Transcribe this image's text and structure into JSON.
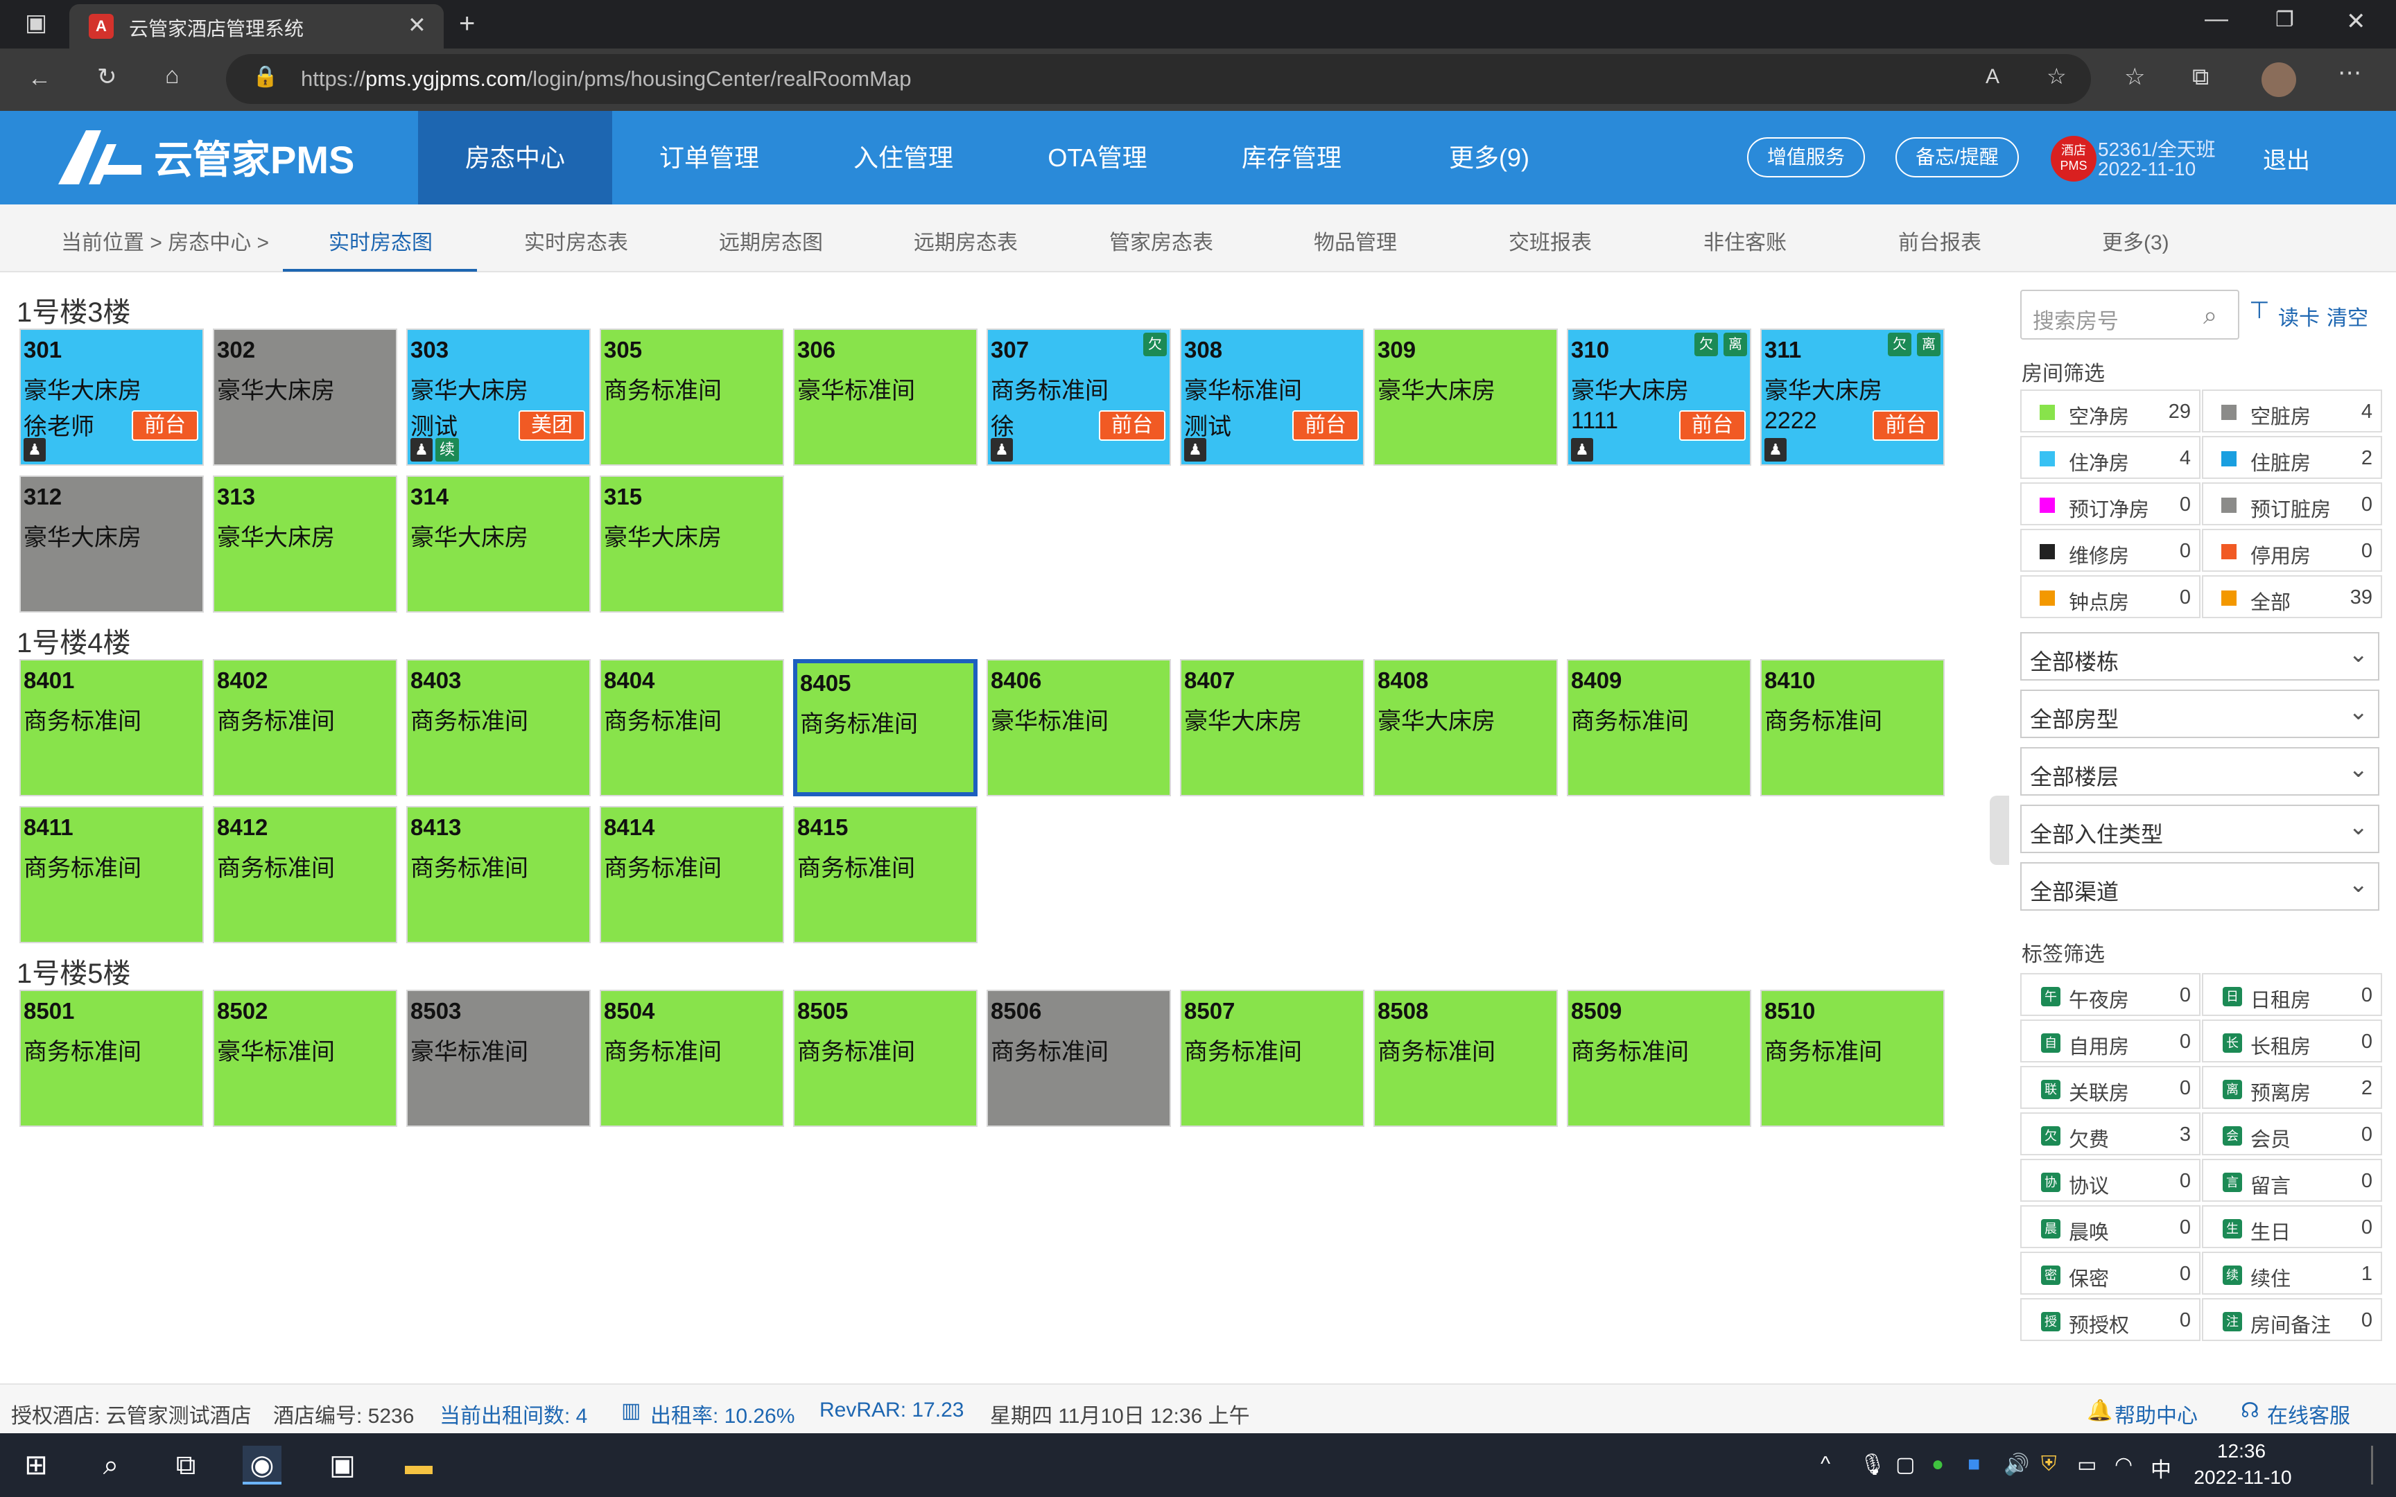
{
  "browser": {
    "tab_title": "云管家酒店管理系统",
    "url_prefix": "https://",
    "url_host": "pms.ygjpms.com",
    "url_path": "/login/pms/housingCenter/realRoomMap"
  },
  "header": {
    "logo": "云管家PMS",
    "nav": [
      "房态中心",
      "订单管理",
      "入住管理",
      "OTA管理",
      "库存管理",
      "更多(9)"
    ],
    "value_added": "增值服务",
    "memo": "备忘/提醒",
    "hotel_logo_text": "酒店PMS",
    "shift": "52361/全天班",
    "date": "2022-11-10",
    "logout": "退出"
  },
  "subnav": {
    "breadcrumb": "当前位置 >  房态中心 >",
    "tabs": [
      "实时房态图",
      "实时房态表",
      "远期房态图",
      "远期房态表",
      "管家房态表",
      "物品管理",
      "交班报表",
      "非住客账",
      "前台报表",
      "更多(3)"
    ]
  },
  "floors": [
    {
      "title": "1号楼3楼",
      "rooms": [
        {
          "no": "301",
          "type": "豪华大床房",
          "status": "blue",
          "guest": "徐老师",
          "source": "前台",
          "person": true
        },
        {
          "no": "302",
          "type": "豪华大床房",
          "status": "gray"
        },
        {
          "no": "303",
          "type": "豪华大床房",
          "status": "blue",
          "guest": "测试",
          "source": "美团",
          "person": true,
          "renew": "续"
        },
        {
          "no": "305",
          "type": "商务标准间",
          "status": "green"
        },
        {
          "no": "306",
          "type": "豪华标准间",
          "status": "green"
        },
        {
          "no": "307",
          "type": "商务标准间",
          "status": "blue",
          "guest": "徐",
          "source": "前台",
          "person": true,
          "badges": [
            "欠"
          ]
        },
        {
          "no": "308",
          "type": "豪华标准间",
          "status": "blue",
          "guest": "测试",
          "source": "前台",
          "person": true
        },
        {
          "no": "309",
          "type": "豪华大床房",
          "status": "green"
        },
        {
          "no": "310",
          "type": "豪华大床房",
          "status": "blue",
          "guest": "1111",
          "source": "前台",
          "person": true,
          "badges": [
            "欠",
            "离"
          ]
        },
        {
          "no": "311",
          "type": "豪华大床房",
          "status": "blue",
          "guest": "2222",
          "source": "前台",
          "person": true,
          "badges": [
            "欠",
            "离"
          ]
        },
        {
          "no": "312",
          "type": "豪华大床房",
          "status": "gray"
        },
        {
          "no": "313",
          "type": "豪华大床房",
          "status": "green"
        },
        {
          "no": "314",
          "type": "豪华大床房",
          "status": "green"
        },
        {
          "no": "315",
          "type": "豪华大床房",
          "status": "green"
        }
      ]
    },
    {
      "title": "1号楼4楼",
      "rooms": [
        {
          "no": "8401",
          "type": "商务标准间",
          "status": "green"
        },
        {
          "no": "8402",
          "type": "商务标准间",
          "status": "green"
        },
        {
          "no": "8403",
          "type": "商务标准间",
          "status": "green"
        },
        {
          "no": "8404",
          "type": "商务标准间",
          "status": "green"
        },
        {
          "no": "8405",
          "type": "商务标准间",
          "status": "green",
          "selected": true
        },
        {
          "no": "8406",
          "type": "豪华标准间",
          "status": "green"
        },
        {
          "no": "8407",
          "type": "豪华大床房",
          "status": "green"
        },
        {
          "no": "8408",
          "type": "豪华大床房",
          "status": "green"
        },
        {
          "no": "8409",
          "type": "商务标准间",
          "status": "green"
        },
        {
          "no": "8410",
          "type": "商务标准间",
          "status": "green"
        },
        {
          "no": "8411",
          "type": "商务标准间",
          "status": "green"
        },
        {
          "no": "8412",
          "type": "商务标准间",
          "status": "green"
        },
        {
          "no": "8413",
          "type": "商务标准间",
          "status": "green"
        },
        {
          "no": "8414",
          "type": "商务标准间",
          "status": "green"
        },
        {
          "no": "8415",
          "type": "商务标准间",
          "status": "green"
        }
      ]
    },
    {
      "title": "1号楼5楼",
      "rooms": [
        {
          "no": "8501",
          "type": "商务标准间",
          "status": "green"
        },
        {
          "no": "8502",
          "type": "豪华标准间",
          "status": "green"
        },
        {
          "no": "8503",
          "type": "豪华标准间",
          "status": "gray"
        },
        {
          "no": "8504",
          "type": "商务标准间",
          "status": "green"
        },
        {
          "no": "8505",
          "type": "商务标准间",
          "status": "green"
        },
        {
          "no": "8506",
          "type": "商务标准间",
          "status": "gray"
        },
        {
          "no": "8507",
          "type": "商务标准间",
          "status": "green"
        },
        {
          "no": "8508",
          "type": "商务标准间",
          "status": "green"
        },
        {
          "no": "8509",
          "type": "商务标准间",
          "status": "green"
        },
        {
          "no": "8510",
          "type": "商务标准间",
          "status": "green"
        }
      ]
    }
  ],
  "sidebar": {
    "search_placeholder": "搜索房号",
    "read_card": "读卡",
    "clear": "清空",
    "room_filter_title": "房间筛选",
    "room_filters": [
      {
        "label": "空净房",
        "count": "29",
        "color": "#88e34b"
      },
      {
        "label": "空脏房",
        "count": "4",
        "color": "#8b8b89"
      },
      {
        "label": "住净房",
        "count": "4",
        "color": "#38c1f3"
      },
      {
        "label": "住脏房",
        "count": "2",
        "color": "#1a9fe0"
      },
      {
        "label": "预订净房",
        "count": "0",
        "color": "#ff00ff"
      },
      {
        "label": "预订脏房",
        "count": "0",
        "color": "#8b8b89"
      },
      {
        "label": "维修房",
        "count": "0",
        "color": "#222222"
      },
      {
        "label": "停用房",
        "count": "0",
        "color": "#f15a24"
      },
      {
        "label": "钟点房",
        "count": "0",
        "color": "#f39800"
      },
      {
        "label": "全部",
        "count": "39",
        "color": "#f39800"
      }
    ],
    "dropdowns": [
      "全部楼栋",
      "全部房型",
      "全部楼层",
      "全部入住类型",
      "全部渠道"
    ],
    "tag_filter_title": "标签筛选",
    "tag_filters": [
      {
        "label": "午夜房",
        "count": "0",
        "icon": "午"
      },
      {
        "label": "日租房",
        "count": "0",
        "icon": "日"
      },
      {
        "label": "自用房",
        "count": "0",
        "icon": "自"
      },
      {
        "label": "长租房",
        "count": "0",
        "icon": "长"
      },
      {
        "label": "关联房",
        "count": "0",
        "icon": "联"
      },
      {
        "label": "预离房",
        "count": "2",
        "icon": "离"
      },
      {
        "label": "欠费",
        "count": "3",
        "icon": "欠"
      },
      {
        "label": "会员",
        "count": "0",
        "icon": "会"
      },
      {
        "label": "协议",
        "count": "0",
        "icon": "协"
      },
      {
        "label": "留言",
        "count": "0",
        "icon": "言"
      },
      {
        "label": "晨唤",
        "count": "0",
        "icon": "晨"
      },
      {
        "label": "生日",
        "count": "0",
        "icon": "生"
      },
      {
        "label": "保密",
        "count": "0",
        "icon": "密"
      },
      {
        "label": "续住",
        "count": "1",
        "icon": "续"
      },
      {
        "label": "预授权",
        "count": "0",
        "icon": "授"
      },
      {
        "label": "房间备注",
        "count": "0",
        "icon": "注"
      }
    ]
  },
  "statusbar": {
    "hotel": "授权酒店: 云管家测试酒店",
    "hotel_no": "酒店编号: 5236",
    "rented": "当前出租间数: 4",
    "occupancy": "出租率: 10.26%",
    "revpar": "RevRAR: 17.23",
    "datetime": "星期四 11月10日 12:36 上午",
    "help": "帮助中心",
    "support": "在线客服"
  },
  "taskbar": {
    "time": "12:36",
    "date": "2022-11-10",
    "ime": "中"
  },
  "colors": {
    "header_blue": "#2a8ad9",
    "nav_active": "#1d66b1",
    "vacant_clean": "#88e34b",
    "occupied": "#38c1f3",
    "dirty": "#8b8b89",
    "source_tag": "#f15a24"
  }
}
